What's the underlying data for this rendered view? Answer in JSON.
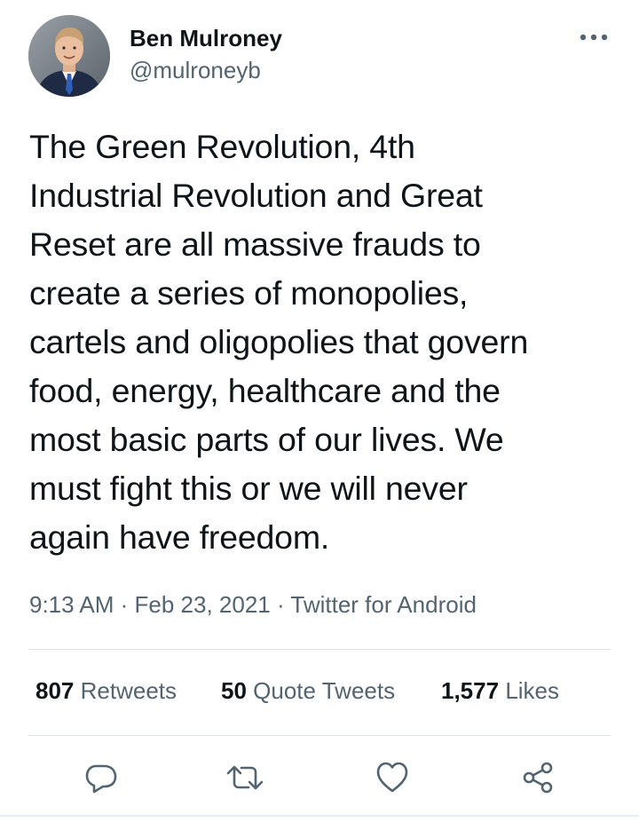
{
  "author": {
    "display_name": "Ben Mulroney",
    "handle": "@mulroneyb"
  },
  "tweet": {
    "text": "The Green Revolution, 4th\nIndustrial Revolution and Great\nReset are all massive frauds to\ncreate a series of monopolies,\ncartels and oligopolies that govern\nfood, energy, healthcare and the\nmost basic parts of our lives. We\nmust fight this or we will never\nagain have freedom."
  },
  "meta": {
    "time": "9:13 AM",
    "separator": " · ",
    "date": "Feb 23, 2021",
    "source": "Twitter for Android"
  },
  "stats": {
    "retweets": {
      "count": "807",
      "label": "Retweets"
    },
    "quotes": {
      "count": "50",
      "label": "Quote Tweets"
    },
    "likes": {
      "count": "1,577",
      "label": "Likes"
    }
  },
  "icons": {
    "more": "more-horizontal-icon",
    "reply": "reply-icon",
    "retweet": "retweet-icon",
    "like": "heart-icon",
    "share": "share-icon"
  },
  "colors": {
    "text": "#0f1419",
    "secondary": "#536471",
    "divider": "#dde3e8"
  }
}
